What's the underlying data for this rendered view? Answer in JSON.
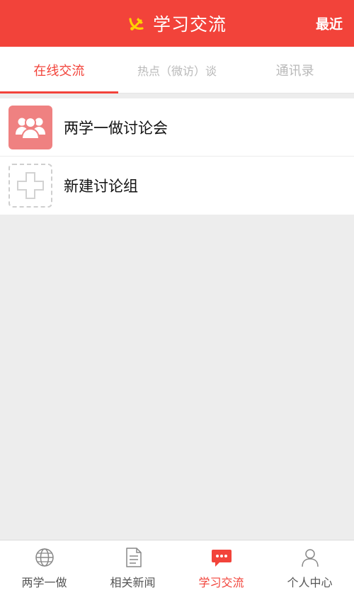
{
  "header": {
    "title": "学习交流",
    "right_label": "最近",
    "emblem_icon": "hammer-sickle-icon"
  },
  "colors": {
    "primary": "#f2433a",
    "avatar": "#ef8181",
    "emblem": "#ffd200"
  },
  "tabs": [
    {
      "label": "在线交流",
      "active": true
    },
    {
      "label": "热点（微访）谈",
      "active": false
    },
    {
      "label": "通讯录",
      "active": false
    }
  ],
  "list": {
    "items": [
      {
        "label": "两学一做讨论会",
        "icon": "group-users-icon"
      },
      {
        "label": "新建讨论组",
        "icon": "add-plus-icon"
      }
    ]
  },
  "bottom_nav": {
    "items": [
      {
        "label": "两学一做",
        "icon": "globe-icon",
        "active": false
      },
      {
        "label": "相关新闻",
        "icon": "document-icon",
        "active": false
      },
      {
        "label": "学习交流",
        "icon": "chat-bubble-icon",
        "active": true
      },
      {
        "label": "个人中心",
        "icon": "user-icon",
        "active": false
      }
    ]
  }
}
